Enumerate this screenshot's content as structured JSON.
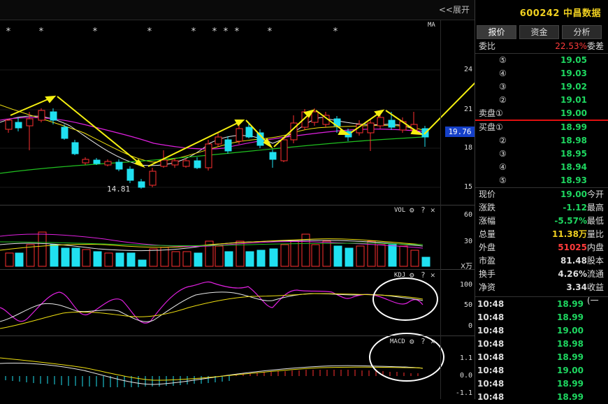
{
  "chart": {
    "expand_label": "<<展开",
    "ma_label": "MA",
    "price_axis": [
      "24",
      "21",
      "18",
      "15"
    ],
    "current_price_tag": "19.76",
    "low_label": "14.81",
    "vol_label": "VOL",
    "vol_axis": [
      "60",
      "30"
    ],
    "vol_unit": "X万",
    "kdj_label": "KDJ",
    "kdj_axis": [
      "100",
      "50",
      "0"
    ],
    "macd_label": "MACD",
    "macd_axis": [
      "1.1",
      "0.0",
      "-1.1"
    ],
    "help_glyph": "?",
    "close_glyph": "✕",
    "star_glyph": "*"
  },
  "panel": {
    "title": "600242 中昌数据",
    "tabs": [
      {
        "label": "报价"
      },
      {
        "label": "资金"
      },
      {
        "label": "分析"
      }
    ],
    "weibi": {
      "label": "委比",
      "value": "22.53%",
      "label2": "委差"
    },
    "sell_levels": [
      {
        "label": "",
        "num": "⑤",
        "price": "19.05"
      },
      {
        "label": "",
        "num": "④",
        "price": "19.03"
      },
      {
        "label": "",
        "num": "③",
        "price": "19.02"
      },
      {
        "label": "",
        "num": "②",
        "price": "19.01"
      },
      {
        "label": "卖盘①",
        "num": "",
        "price": "19.00"
      }
    ],
    "buy_levels": [
      {
        "label": "买盘①",
        "num": "",
        "price": "18.99"
      },
      {
        "label": "",
        "num": "②",
        "price": "18.98"
      },
      {
        "label": "",
        "num": "③",
        "price": "18.95"
      },
      {
        "label": "",
        "num": "④",
        "price": "18.94"
      },
      {
        "label": "",
        "num": "⑤",
        "price": "18.93"
      }
    ],
    "stats": [
      {
        "label": "现价",
        "value": "19.00",
        "label2": "今开"
      },
      {
        "label": "涨跌",
        "value": "-1.12",
        "label2": "最高"
      },
      {
        "label": "涨幅",
        "value": "-5.57%",
        "label2": "最低"
      },
      {
        "label": "总量",
        "value": "11.38万",
        "label2": "量比"
      },
      {
        "label": "外盘",
        "value": "51025",
        "label2": "内盘"
      },
      {
        "label": "市盈",
        "value": "81.48",
        "label2": "股本"
      },
      {
        "label": "换手",
        "value": "4.26%",
        "label2": "流通"
      },
      {
        "label": "净资",
        "value": "3.34",
        "label2": "收益(一"
      }
    ],
    "trades": [
      {
        "time": "10:48",
        "price": "18.99"
      },
      {
        "time": "10:48",
        "price": "18.99"
      },
      {
        "time": "10:48",
        "price": "19.00"
      },
      {
        "time": "10:48",
        "price": "18.98"
      },
      {
        "time": "10:48",
        "price": "18.99"
      },
      {
        "time": "10:48",
        "price": "19.00"
      },
      {
        "time": "10:48",
        "price": "18.99"
      },
      {
        "time": "10:48",
        "price": "18.99"
      }
    ]
  }
}
